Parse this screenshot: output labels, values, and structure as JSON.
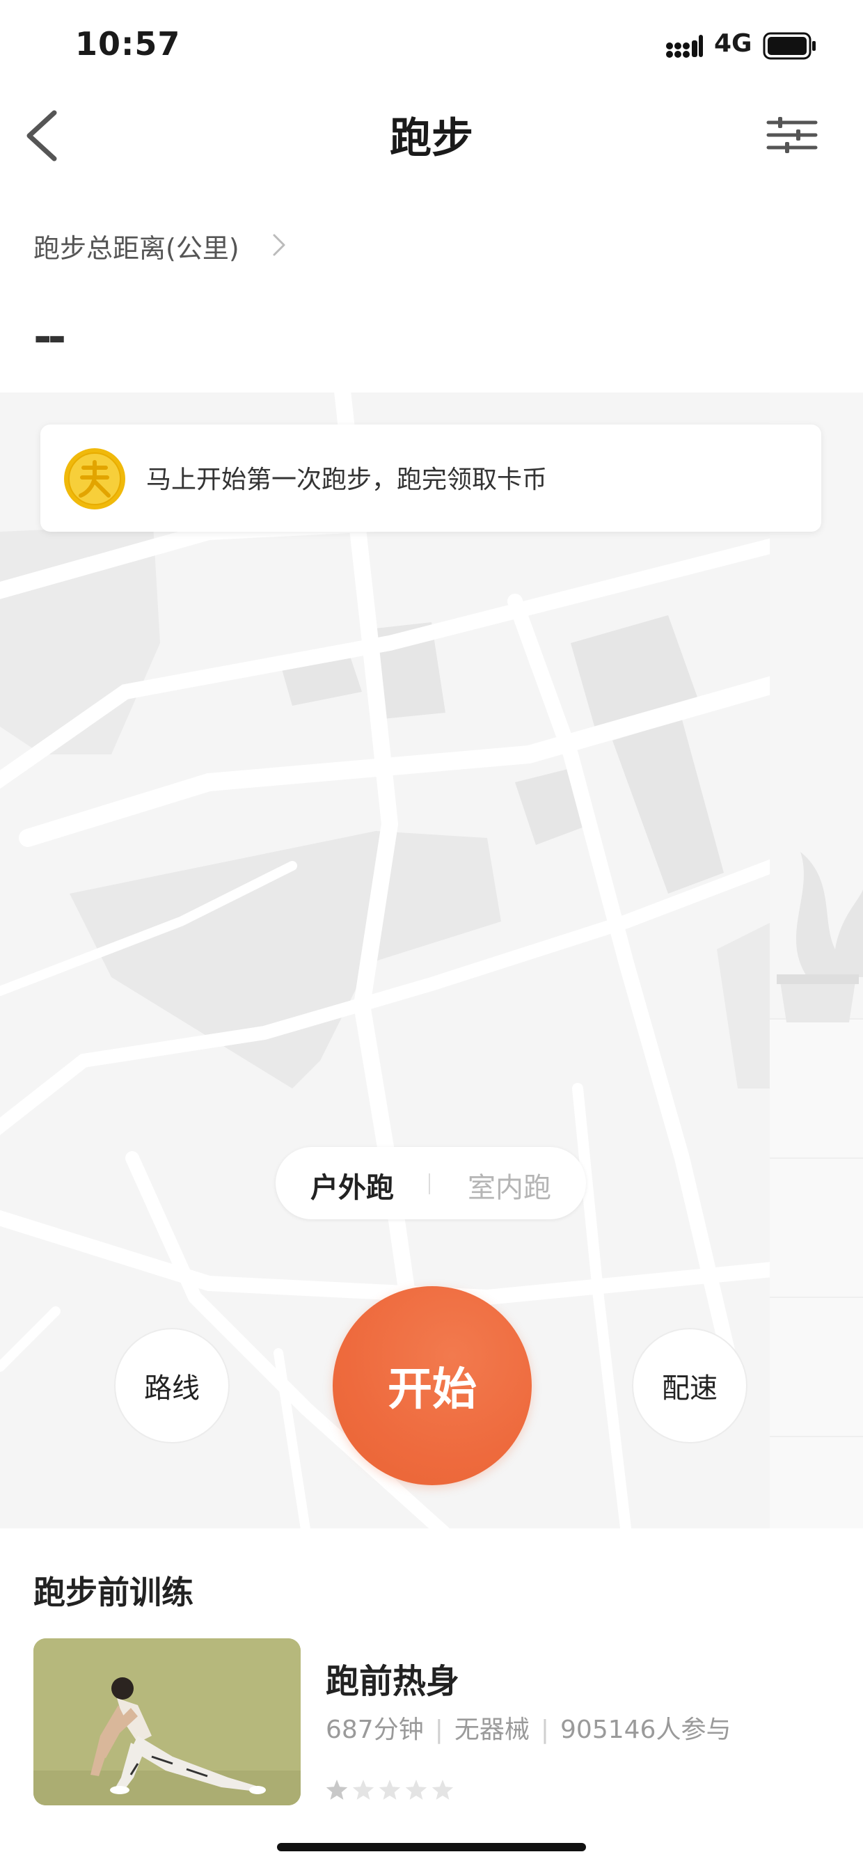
{
  "status_bar": {
    "time": "10:57",
    "network": "4G"
  },
  "nav": {
    "title": "跑步"
  },
  "distance": {
    "label": "跑步总距离(公里)",
    "value": "--"
  },
  "banner": {
    "text": "马上开始第一次跑步，跑完领取卡币"
  },
  "mode": {
    "outdoor": "户外跑",
    "indoor": "室内跑",
    "selected": "outdoor"
  },
  "controls": {
    "route": "路线",
    "start": "开始",
    "pace": "配速"
  },
  "training": {
    "section_title": "跑步前训练",
    "course": {
      "title": "跑前热身",
      "duration": "687分钟",
      "equipment": "无器械",
      "participants": "905146人参与",
      "rating_stars": 1,
      "rating_max": 5
    }
  },
  "colors": {
    "accent": "#EE6A3D",
    "coin": "#F5C518",
    "map_bg": "#F5F5F5"
  }
}
